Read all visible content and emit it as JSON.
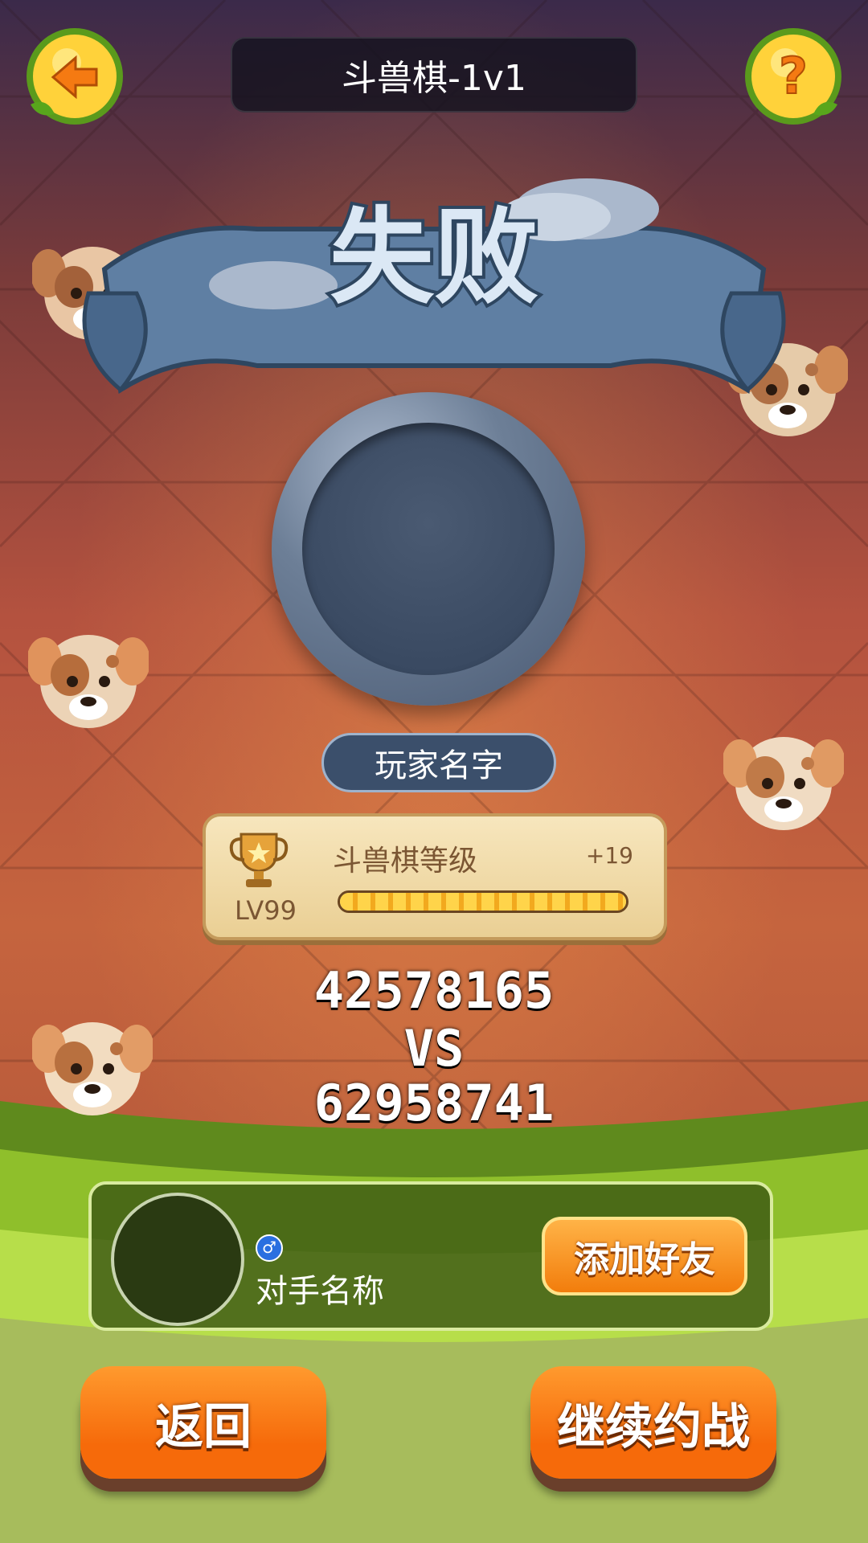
{
  "header": {
    "title": "斗兽棋-1v1"
  },
  "result": {
    "text": "失败"
  },
  "player": {
    "name": "玩家名字"
  },
  "rank": {
    "title": "斗兽棋等级",
    "gain": "+19",
    "level": "LV99",
    "progress": 1.0
  },
  "scores": {
    "player": "42578165",
    "vs": "VS",
    "opponent": "62958741"
  },
  "opponent": {
    "gender_symbol": "♂",
    "name": "对手名称",
    "add_friend_label": "添加好友"
  },
  "buttons": {
    "back_label": "返回",
    "continue_label": "继续约战"
  },
  "icons": {
    "back": "back-arrow-icon",
    "help": "question-mark-icon",
    "trophy": "trophy-icon",
    "gender": "male-gender-icon"
  },
  "colors": {
    "accent_orange": "#f66a0a",
    "panel_green": "#3c5814",
    "ribbon_blue": "#5f7fa3"
  }
}
